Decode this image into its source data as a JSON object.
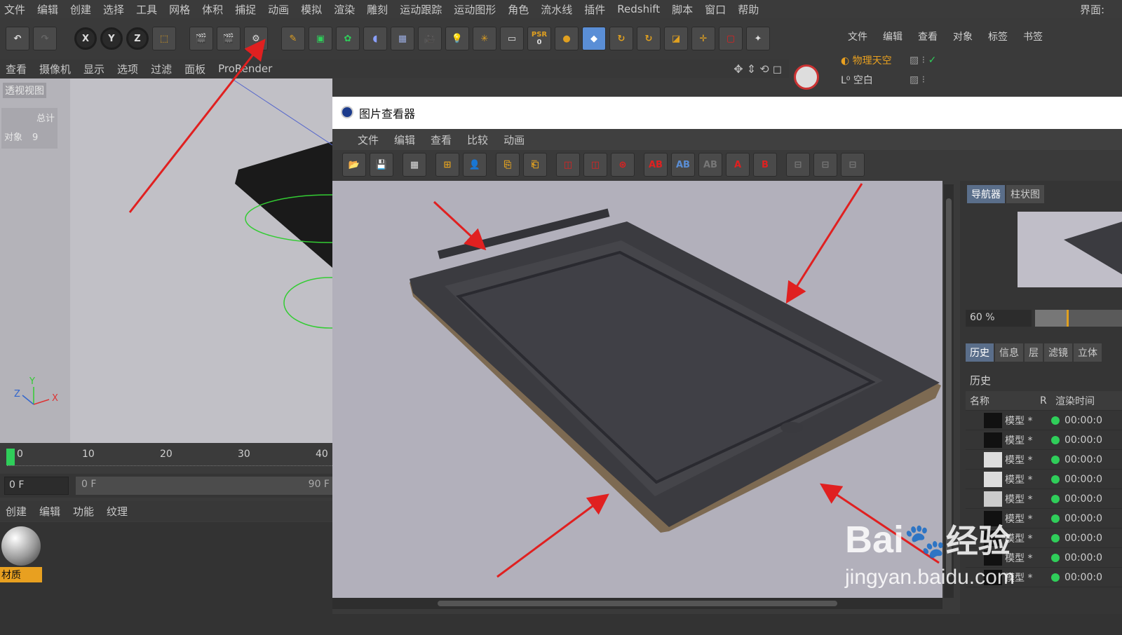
{
  "menubar": {
    "items": [
      "文件",
      "编辑",
      "创建",
      "选择",
      "工具",
      "网格",
      "体积",
      "捕捉",
      "动画",
      "模拟",
      "渲染",
      "雕刻",
      "运动跟踪",
      "运动图形",
      "角色",
      "流水线",
      "插件",
      "Redshift",
      "脚本",
      "窗口",
      "帮助"
    ],
    "right": "界面:"
  },
  "toolbar": {
    "axis": [
      "X",
      "Y",
      "Z"
    ],
    "psr_top": "PSR",
    "psr_bottom": "0"
  },
  "viewport": {
    "menu": [
      "查看",
      "摄像机",
      "显示",
      "选项",
      "过滤",
      "面板",
      "ProRender"
    ],
    "label": "透视视图",
    "stats_header": "总计",
    "stats_label": "对象",
    "stats_value": "9"
  },
  "timeline": {
    "ticks": [
      "0",
      "10",
      "20",
      "30",
      "40"
    ],
    "current_frame": "0 F",
    "range_start": "0 F",
    "range_end": "90 F"
  },
  "material": {
    "menu": [
      "创建",
      "编辑",
      "功能",
      "纹理"
    ],
    "item": "材质"
  },
  "objects": {
    "menu": [
      "文件",
      "编辑",
      "查看",
      "对象",
      "标签",
      "书签"
    ],
    "items": [
      "物理天空",
      "空白"
    ]
  },
  "viewer": {
    "title": "图片查看器",
    "menu": [
      "文件",
      "编辑",
      "查看",
      "比较",
      "动画"
    ],
    "tabs_top": [
      "导航器",
      "柱状图"
    ],
    "zoom": "60 %",
    "tabs_bottom": [
      "历史",
      "信息",
      "层",
      "滤镜",
      "立体"
    ],
    "history_title": "历史",
    "col_name": "名称",
    "col_r": "R",
    "col_time": "渲染时间",
    "rows": [
      {
        "name": "模型 *",
        "time": "00:00:0"
      },
      {
        "name": "模型 *",
        "time": "00:00:0"
      },
      {
        "name": "模型 *",
        "time": "00:00:0"
      },
      {
        "name": "模型 *",
        "time": "00:00:0"
      },
      {
        "name": "模型 *",
        "time": "00:00:0"
      },
      {
        "name": "模型 *",
        "time": "00:00:0"
      },
      {
        "name": "模型 *",
        "time": "00:00:0"
      },
      {
        "name": "模型 *",
        "time": "00:00:0"
      },
      {
        "name": "模型 *",
        "time": "00:00:0"
      }
    ]
  },
  "watermark": {
    "brand": "Bai",
    "brand2": "经验",
    "url": "jingyan.baidu.com"
  },
  "colors": {
    "accent": "#e0a020",
    "arrow": "#e02020",
    "status_dot": "#2fce5a"
  }
}
